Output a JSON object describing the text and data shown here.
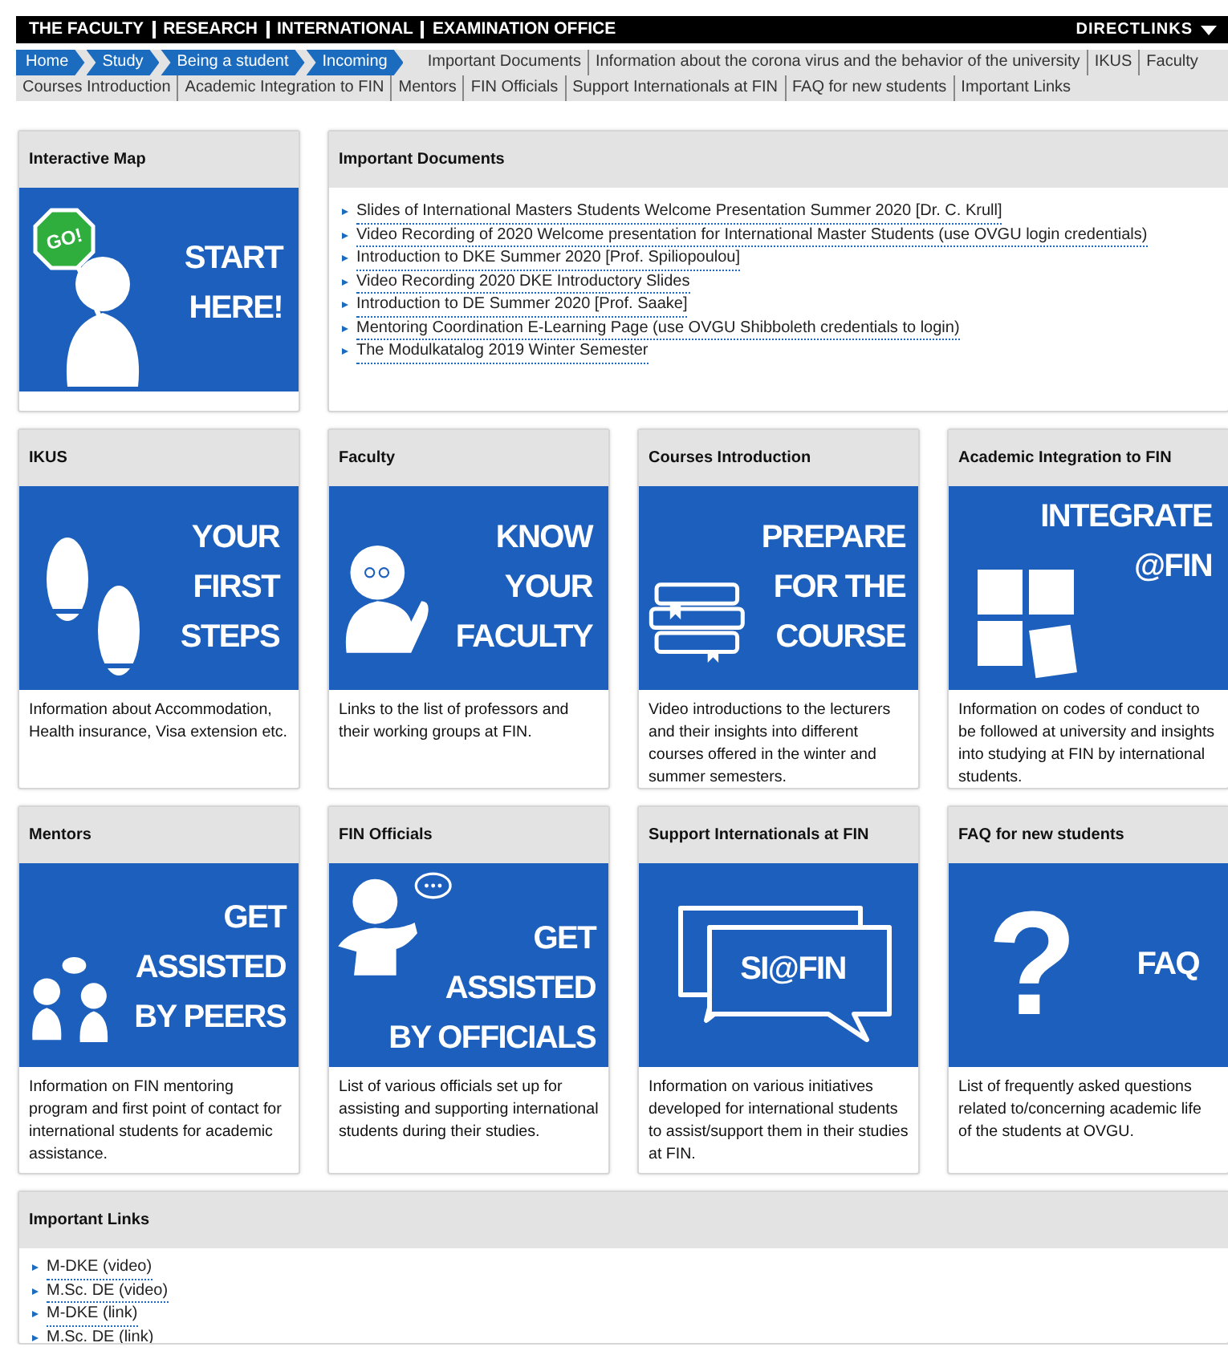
{
  "top_bar": {
    "menu": [
      "THE FACULTY",
      "RESEARCH",
      "INTERNATIONAL",
      "EXAMINATION OFFICE"
    ],
    "directlinks": "DIRECTLINKS"
  },
  "breadcrumb": {
    "crumbs": [
      "Home",
      "Study",
      "Being a student",
      "Incoming"
    ],
    "links": [
      "Important Documents",
      "Information about the corona virus and the behavior of the university",
      "IKUS",
      "Faculty",
      "Courses Introduction",
      "Academic Integration to FIN",
      "Mentors",
      "FIN Officials",
      "Support Internationals at FIN",
      "FAQ for new students",
      "Important Links"
    ]
  },
  "interactive_map": {
    "title": "Interactive Map",
    "banner": {
      "kind": "go-sign",
      "sign_text": "GO!",
      "headline": [
        "START",
        "HERE!"
      ]
    }
  },
  "important_documents": {
    "title": "Important Documents",
    "links": [
      "Slides of International Masters Students Welcome Presentation Summer 2020 [Dr. C. Krull]",
      "Video Recording of 2020 Welcome presentation for International Master Students (use OVGU login credentials)",
      "Introduction to DKE Summer 2020 [Prof. Spiliopoulou]",
      "Video Recording 2020 DKE Introductory Slides",
      "Introduction to DE Summer 2020 [Prof. Saake]",
      "Mentoring Coordination E-Learning Page (use OVGU Shibboleth credentials to login)",
      "The Modulkatalog 2019 Winter Semester"
    ]
  },
  "cards": [
    {
      "title": "IKUS",
      "banner": {
        "kind": "footprints",
        "headline": [
          "YOUR",
          "FIRST",
          "STEPS"
        ]
      },
      "description": "Information about Accommodation, Health insurance, Visa extension etc."
    },
    {
      "title": "Faculty",
      "banner": {
        "kind": "person",
        "headline": [
          "KNOW",
          "YOUR",
          "FACULTY"
        ]
      },
      "description": "Links to the list of professors and their working groups at FIN."
    },
    {
      "title": "Courses Introduction",
      "banner": {
        "kind": "books",
        "headline": [
          "PREPARE",
          "FOR THE",
          "COURSE"
        ]
      },
      "description": "Video introductions to the lecturers and their insights into different courses offered in the winter and summer semesters."
    },
    {
      "title": "Academic Integration to FIN",
      "banner": {
        "kind": "puzzle",
        "headline": [
          "INTEGRATE",
          "@FIN"
        ]
      },
      "description": "Information on codes of conduct to be followed at university and insights into studying at FIN by international students."
    },
    {
      "title": "Mentors",
      "banner": {
        "kind": "peers",
        "headline": [
          "GET",
          "ASSISTED",
          "BY PEERS"
        ]
      },
      "description": "Information on FIN mentoring program and first point of contact for international students for academic assistance."
    },
    {
      "title": "FIN Officials",
      "banner": {
        "kind": "official",
        "headline": [
          "GET",
          "ASSISTED",
          "BY OFFICIALS"
        ]
      },
      "description": "List of various officials set up for assisting and supporting international students during their studies."
    },
    {
      "title": "Support Internationals at FIN",
      "banner": {
        "kind": "bubbles",
        "headline": [
          "SI@FIN"
        ]
      },
      "description": "Information on various initiatives developed for international students to assist/support them in their studies at FIN."
    },
    {
      "title": "FAQ for new students",
      "banner": {
        "kind": "faq",
        "symbol": "?",
        "headline": [
          "FAQ"
        ]
      },
      "description": "List of frequently asked questions related to/concerning academic life of the students at OVGU."
    }
  ],
  "important_links": {
    "title": "Important Links",
    "links": [
      "M-DKE (video)",
      "M.Sc. DE (video)",
      "M-DKE (link)",
      "M.Sc. DE (link)"
    ]
  }
}
